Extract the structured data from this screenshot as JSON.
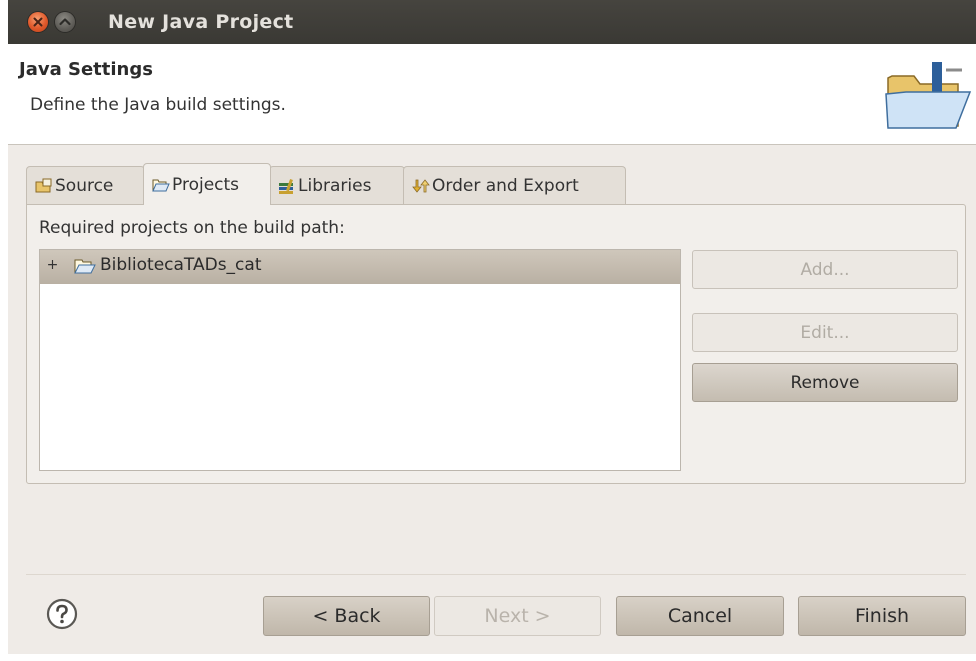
{
  "window": {
    "title": "New Java Project"
  },
  "banner": {
    "title": "Java Settings",
    "description": "Define the Java build settings."
  },
  "tabs": [
    {
      "label": "Source",
      "icon": "source-folder-icon",
      "active": false
    },
    {
      "label": "Projects",
      "icon": "project-folder-icon",
      "active": true
    },
    {
      "label": "Libraries",
      "icon": "libraries-icon",
      "active": false
    },
    {
      "label": "Order and Export",
      "icon": "order-export-icon",
      "active": false
    }
  ],
  "projects_panel": {
    "label": "Required projects on the build path:",
    "items": [
      {
        "label": "BibliotecaTADs_cat",
        "expander": "+",
        "selected": true
      }
    ],
    "buttons": {
      "add": "Add...",
      "edit": "Edit...",
      "remove": "Remove"
    }
  },
  "footer": {
    "back": "< Back",
    "next": "Next >",
    "cancel": "Cancel",
    "finish": "Finish"
  },
  "colors": {
    "titlebar": "#3c3b37",
    "close_button": "#e0582a",
    "selection": "#c3bbaf"
  }
}
